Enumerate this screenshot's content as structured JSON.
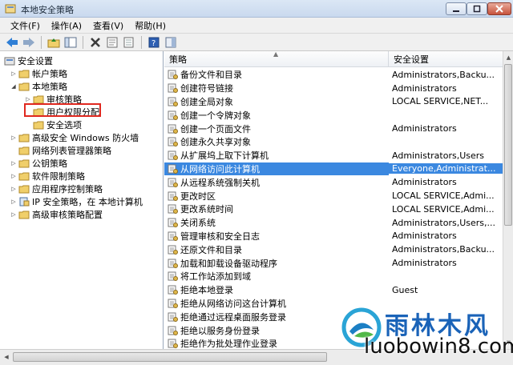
{
  "window": {
    "title": "本地安全策略"
  },
  "menu": [
    "文件(F)",
    "操作(A)",
    "查看(V)",
    "帮助(H)"
  ],
  "tree": [
    {
      "label": "安全设置"
    },
    {
      "label": "帐户策略"
    },
    {
      "label": "本地策略"
    },
    {
      "label": "审核策略"
    },
    {
      "label": "用户权限分配"
    },
    {
      "label": "安全选项"
    },
    {
      "label": "高级安全 Windows 防火墙"
    },
    {
      "label": "网络列表管理器策略"
    },
    {
      "label": "公钥策略"
    },
    {
      "label": "软件限制策略"
    },
    {
      "label": "应用程序控制策略"
    },
    {
      "label": "IP 安全策略，在 本地计算机"
    },
    {
      "label": "高级审核策略配置"
    }
  ],
  "columns": {
    "policy": "策略",
    "setting": "安全设置"
  },
  "rows": [
    {
      "policy": "备份文件和目录",
      "setting": "Administrators,Backu..."
    },
    {
      "policy": "创建符号链接",
      "setting": "Administrators"
    },
    {
      "policy": "创建全局对象",
      "setting": "LOCAL SERVICE,NET..."
    },
    {
      "policy": "创建一个令牌对象",
      "setting": ""
    },
    {
      "policy": "创建一个页面文件",
      "setting": "Administrators"
    },
    {
      "policy": "创建永久共享对象",
      "setting": ""
    },
    {
      "policy": "从扩展坞上取下计算机",
      "setting": "Administrators,Users"
    },
    {
      "policy": "从网络访问此计算机",
      "setting": "Everyone,Administrat..."
    },
    {
      "policy": "从远程系统强制关机",
      "setting": "Administrators"
    },
    {
      "policy": "更改时区",
      "setting": "LOCAL SERVICE,Admi..."
    },
    {
      "policy": "更改系统时间",
      "setting": "LOCAL SERVICE,Admi..."
    },
    {
      "policy": "关闭系统",
      "setting": "Administrators,Users,..."
    },
    {
      "policy": "管理审核和安全日志",
      "setting": "Administrators"
    },
    {
      "policy": "还原文件和目录",
      "setting": "Administrators,Backu..."
    },
    {
      "policy": "加载和卸载设备驱动程序",
      "setting": "Administrators"
    },
    {
      "policy": "将工作站添加到域",
      "setting": ""
    },
    {
      "policy": "拒绝本地登录",
      "setting": "Guest"
    },
    {
      "policy": "拒绝从网络访问这台计算机",
      "setting": ""
    },
    {
      "policy": "拒绝通过远程桌面服务登录",
      "setting": ""
    },
    {
      "policy": "拒绝以服务身份登录",
      "setting": ""
    },
    {
      "policy": "拒绝作为批处理作业登录",
      "setting": ""
    }
  ],
  "watermark": {
    "brand": "雨林木风",
    "url": "luobowin8.com"
  }
}
